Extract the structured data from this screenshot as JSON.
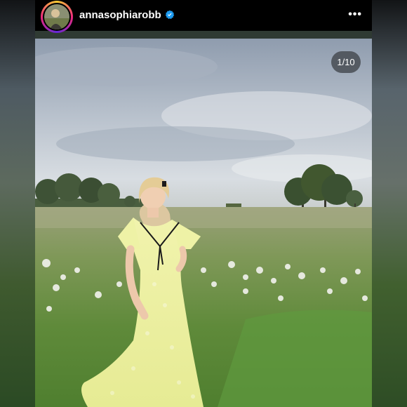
{
  "post": {
    "username": "annasophiarobb",
    "verified": true,
    "verified_icon": "verified-badge-icon",
    "more_icon": "more-options-icon",
    "more_label": "•••",
    "carousel_counter": "1/10"
  },
  "colors": {
    "header_bg": "#000000",
    "verified_blue": "#1d9bf0",
    "dress": "#eef0a0"
  }
}
